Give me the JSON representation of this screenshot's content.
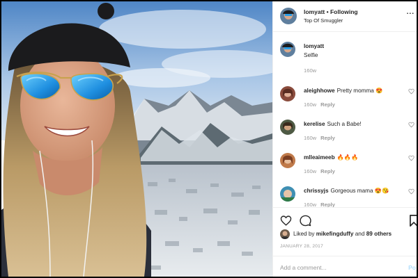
{
  "header": {
    "username": "lomyatt",
    "separator": "•",
    "follow_label": "Following",
    "location": "Top Of Smuggler",
    "more_label": "..."
  },
  "caption": {
    "username": "lomyatt",
    "text": "Selfie",
    "time": "160w"
  },
  "comments": [
    {
      "username": "aleighhowe",
      "text": "Pretty momma 😍",
      "time": "160w",
      "reply": "Reply"
    },
    {
      "username": "kerelise",
      "text": "Such a Babe!",
      "time": "160w",
      "reply": "Reply"
    },
    {
      "username": "mlleaimeeb",
      "text": "🔥🔥🔥",
      "time": "160w",
      "reply": "Reply"
    },
    {
      "username": "chrissyjs",
      "text": "Gorgeous mama 😍😘",
      "time": "160w",
      "reply": "Reply"
    }
  ],
  "likes": {
    "prefix": "Liked by",
    "user": "mikefingduffy",
    "middle": "and",
    "others": "89 others"
  },
  "date": "JANUARY 28, 2017",
  "add_comment": {
    "placeholder": "Add a comment...",
    "post_label": "Po"
  },
  "icons": {
    "like": "heart-icon",
    "comment": "comment-bubble-icon",
    "save": "bookmark-icon",
    "more": "more-icon"
  },
  "colors": {
    "text": "#262626",
    "muted": "#999999",
    "border": "#efefef",
    "post_button": "#b2dffc",
    "lens": "#2a9ee8"
  }
}
